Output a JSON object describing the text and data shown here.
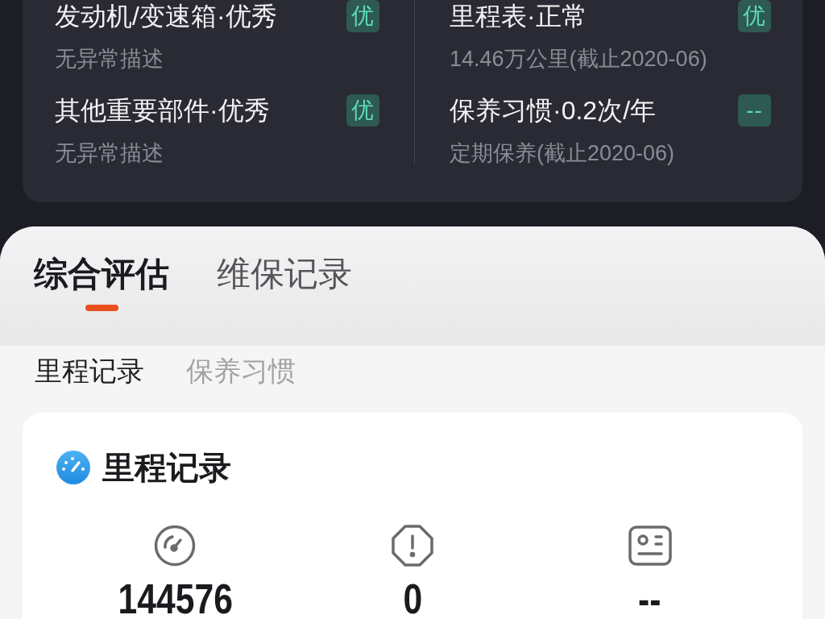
{
  "summary_card": {
    "items": [
      {
        "title": "发动机/变速箱·优秀",
        "description": "无异常描述",
        "badge": "优"
      },
      {
        "title": "里程表·正常",
        "description": "14.46万公里(截止2020-06)",
        "badge": "优"
      },
      {
        "title": "其他重要部件·优秀",
        "description": "无异常描述",
        "badge": "优"
      },
      {
        "title": "保养习惯·0.2次/年",
        "description": "定期保养(截止2020-06)",
        "badge": "--"
      }
    ]
  },
  "main_tabs": [
    {
      "label": "综合评估",
      "selected": true
    },
    {
      "label": "维保记录",
      "selected": false
    }
  ],
  "sub_tabs": [
    {
      "label": "里程记录",
      "selected": true
    },
    {
      "label": "保养习惯",
      "selected": false
    }
  ],
  "mileage_card": {
    "title": "里程记录",
    "stats": [
      {
        "value": "144576"
      },
      {
        "value": "0"
      },
      {
        "value": "--"
      }
    ]
  }
}
